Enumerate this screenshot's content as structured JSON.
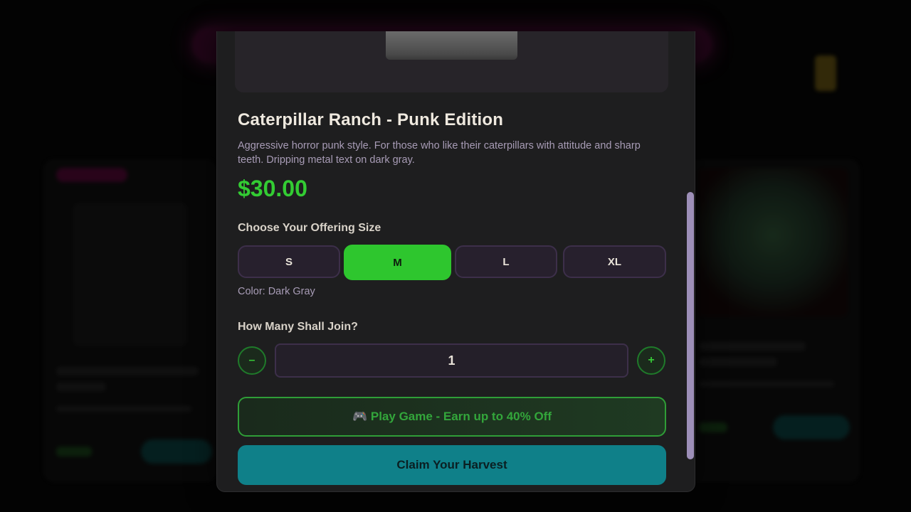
{
  "product": {
    "title": "Caterpillar Ranch - Punk Edition",
    "description": "Aggressive horror punk style. For those who like their caterpillars with attitude and sharp teeth. Dripping metal text on dark gray.",
    "price": "$30.00",
    "color_label": "Color: Dark Gray"
  },
  "size": {
    "label": "Choose Your Offering Size",
    "options": [
      "S",
      "M",
      "L",
      "XL"
    ],
    "selected": "M"
  },
  "quantity": {
    "label": "How Many Shall Join?",
    "value": "1",
    "decrement_label": "–",
    "increment_label": "+"
  },
  "actions": {
    "game_label": "🎮 Play Game - Earn up to 40% Off",
    "claim_label": "Claim Your Harvest"
  },
  "colors": {
    "accent_green": "#2ec62e",
    "price_green": "#33cc33",
    "claim_teal": "#0f8089",
    "scrollbar": "#9d8fb8"
  }
}
